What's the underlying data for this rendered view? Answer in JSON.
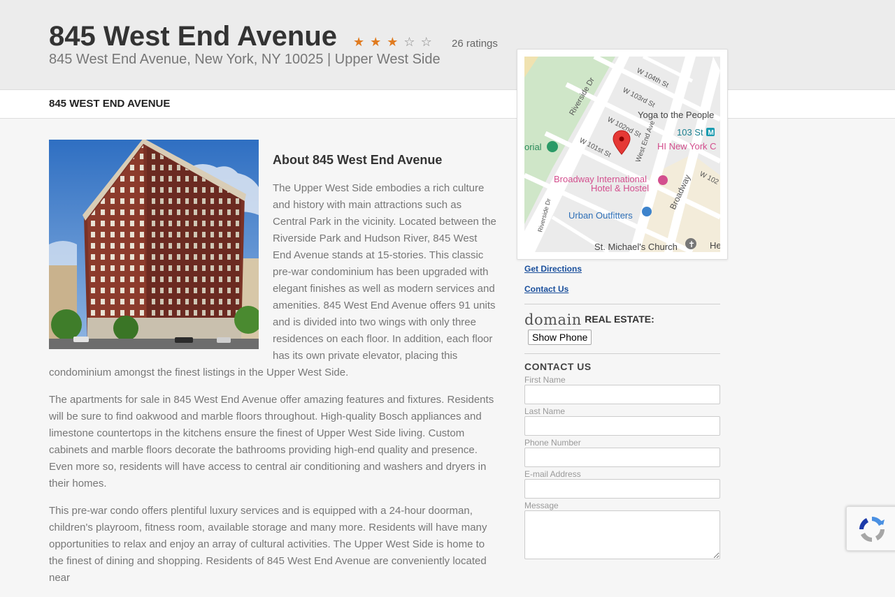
{
  "header": {
    "title": "845 West End Avenue",
    "rating": {
      "value": 3,
      "max": 5,
      "count_label": "26 ratings"
    },
    "address": "845 West End Avenue, New York, NY 10025 | Upper West Side"
  },
  "nav": {
    "item": "845 WEST END AVENUE"
  },
  "article": {
    "about_title": "About 845 West End Avenue",
    "paragraphs": [
      "The Upper West Side embodies a rich culture and history with main attractions such as Central Park in the vicinity. Located between the Riverside Park and Hudson River, 845 West End Avenue stands at 15-stories. This classic pre-war condominium has been upgraded with elegant finishes as well as modern services and amenities. 845 West End Avenue offers 91 units and is divided into two wings with only three residences on each floor. In addition, each floor has its own private elevator, placing this condominium amongst the finest listings in the Upper West Side.",
      "The apartments for sale in 845 West End Avenue offer amazing features and fixtures. Residents will be sure to find oakwood and marble floors throughout. High-quality Bosch appliances and limestone countertops in the kitchens ensure the finest of Upper West Side living. Custom cabinets and marble floors decorate the bathrooms providing high-end quality and presence. Even more so, residents will have access to central air conditioning and washers and dryers in their homes.",
      "This pre-war condo offers plentiful luxury services and is equipped with a 24-hour doorman, children's playroom, fitness room, available storage and many more. Residents will have many opportunities to relax and enjoy an array of cultural activities. The Upper West Side is home to the finest of dining and shopping. Residents of 845 West End Avenue are conveniently located near"
    ]
  },
  "map": {
    "labels": {
      "w104": "W 104th St",
      "w103": "W 103rd St",
      "w102": "W 102nd St",
      "w101": "W 101st St",
      "w102b": "W 102",
      "riverside_dr": "Riverside Dr",
      "riverside_dr2": "Riverside Dr",
      "west_end_ave": "West End Ave",
      "broadway": "Broadway",
      "yoga": "Yoga to the People",
      "station": "103 St",
      "hi_ny": "HI New York C",
      "broadway_hotel_1": "Broadway International",
      "broadway_hotel_2": "Hotel & Hostel",
      "urban": "Urban Outfitters",
      "church": "St. Michael's Church",
      "memorial": "orial",
      "he": "He"
    }
  },
  "sidebar": {
    "get_directions": "Get Directions",
    "contact_us_link": "Contact Us",
    "brokerage_logo": "domain",
    "brokerage_label": "REAL ESTATE:",
    "show_phone": "Show Phone",
    "contact_title": "CONTACT US",
    "form": {
      "first_name": "First Name",
      "last_name": "Last Name",
      "phone": "Phone Number",
      "email": "E-mail Address",
      "message": "Message"
    }
  }
}
